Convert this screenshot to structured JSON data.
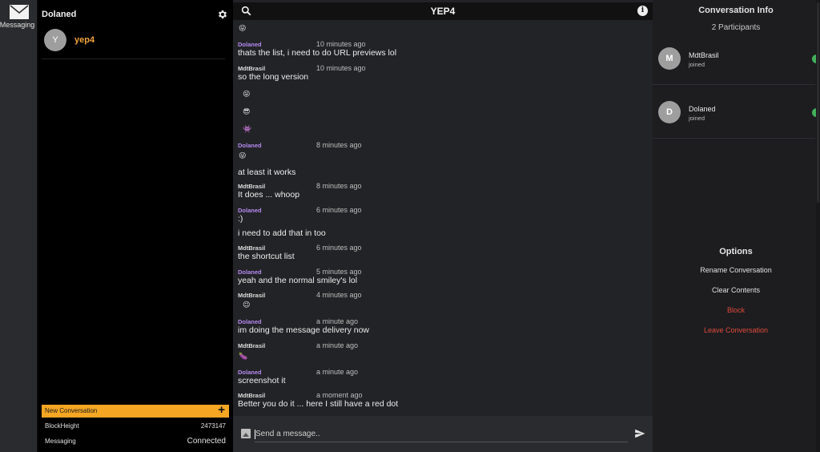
{
  "rail": {
    "app_label": "Messaging"
  },
  "sidebar": {
    "user": "Dolaned",
    "conversations": [
      {
        "avatar": "Y",
        "name": "yep4"
      }
    ],
    "new_conversation": "New Conversation",
    "new_conversation_icon": "+",
    "stats": [
      {
        "label": "BlockHeight",
        "value": "2473147"
      },
      {
        "label": "Messaging",
        "value": "Connected"
      }
    ]
  },
  "chat": {
    "title": "YEP4",
    "info_glyph": "i",
    "composer_placeholder": "Send a message..",
    "messages": [
      {
        "sender": "Dolaned",
        "time": "10 minutes ago",
        "lines": [
          "thats the list, i need to do URL previews lol"
        ]
      },
      {
        "sender": "MdtBrasil",
        "time": "10 minutes ago",
        "lines": [
          "so the long version"
        ]
      },
      {
        "sender": "Dolaned",
        "time": "8 minutes ago",
        "lines": [
          "at least it works"
        ]
      },
      {
        "sender": "MdtBrasil",
        "time": "8 minutes ago",
        "lines": [
          "It does ... whoop"
        ]
      },
      {
        "sender": "Dolaned",
        "time": "6 minutes ago",
        "lines": [
          ":)",
          "i need to add that in too"
        ]
      },
      {
        "sender": "MdtBrasil",
        "time": "6 minutes ago",
        "lines": [
          "the shortcut list"
        ]
      },
      {
        "sender": "Dolaned",
        "time": "5 minutes ago",
        "lines": [
          "yeah and the normal smiley's lol"
        ]
      },
      {
        "sender": "MdtBrasil",
        "time": "4 minutes ago",
        "lines": []
      },
      {
        "sender": "Dolaned",
        "time": "a minute ago",
        "lines": [
          "im doing the message delivery now"
        ]
      },
      {
        "sender": "MdtBrasil",
        "time": "a minute ago",
        "lines": []
      },
      {
        "sender": "Dolaned",
        "time": "a minute ago",
        "lines": [
          "screenshot it"
        ]
      },
      {
        "sender": "MdtBrasil",
        "time": "a moment ago",
        "lines": [
          "Better you do it ... here I still have a red dot"
        ]
      }
    ],
    "emojis": {
      "top": "😜",
      "long_version": [
        "😜",
        "😎",
        "👾"
      ],
      "dolaned_8min": "😜",
      "mdt_4min": "😉",
      "mdt_1min": "🍆"
    }
  },
  "info": {
    "title": "Conversation Info",
    "participants_count": "2 Participants",
    "participants": [
      {
        "avatar": "M",
        "name": "MdtBrasil",
        "status": "joined"
      },
      {
        "avatar": "D",
        "name": "Dolaned",
        "status": "joined"
      }
    ],
    "options_title": "Options",
    "options": [
      "Rename Conversation",
      "Clear Contents",
      "Block",
      "Leave Conversation"
    ]
  },
  "colors": {
    "accent": "#f5a623",
    "dolaned_name": "#b58af0",
    "online": "#43b05c",
    "danger": "#e04a3a"
  }
}
